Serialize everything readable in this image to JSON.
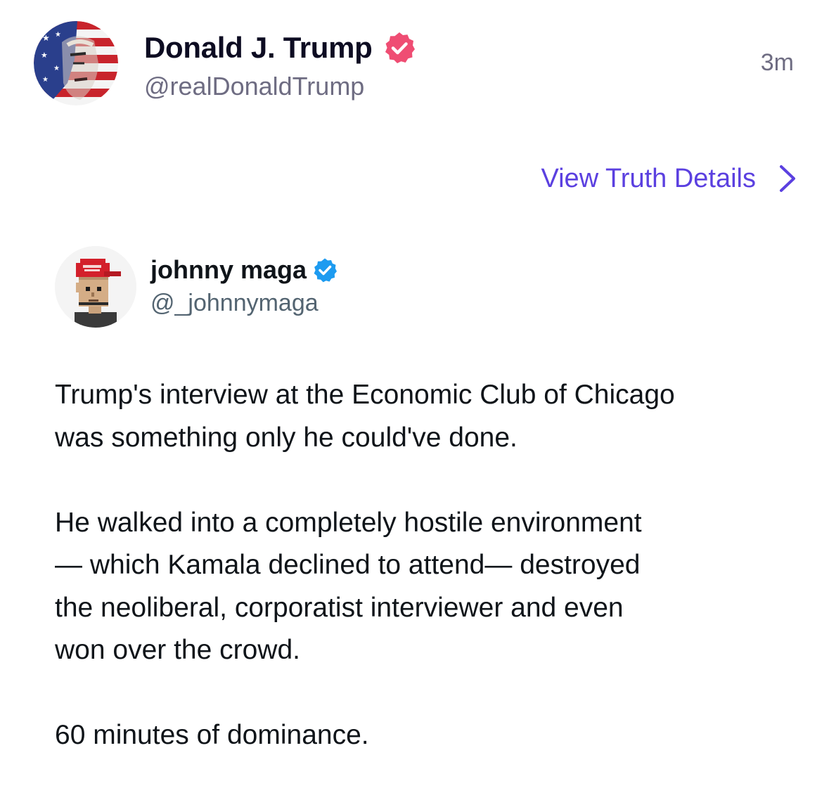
{
  "truth": {
    "author_name": "Donald J. Trump",
    "author_handle": "@realDonaldTrump",
    "timestamp": "3m",
    "verified_color": "#ef4d73",
    "view_details_label": "View Truth Details",
    "link_color": "#5b40e0"
  },
  "embedded_tweet": {
    "author_name": "johnny maga",
    "author_handle": "@_johnnymaga",
    "verified_color": "#1d9bf0",
    "paragraphs": [
      {
        "lines": [
          "Trump's interview at the Economic Club of Chicago",
          "was something only he could've done."
        ]
      },
      {
        "lines": [
          "He walked into a completely hostile environment",
          "— which Kamala declined to attend— destroyed",
          "the neoliberal, corporatist interviewer and even",
          "won over the crowd."
        ]
      },
      {
        "lines": [
          "60 minutes of dominance."
        ]
      }
    ]
  },
  "icons": {
    "truth_avatar": "flag-portrait-avatar",
    "truth_verified": "verified-badge-icon",
    "chevron": "chevron-right-icon",
    "tweet_avatar": "pixel-maga-hat-avatar",
    "tweet_verified": "verified-badge-icon"
  }
}
